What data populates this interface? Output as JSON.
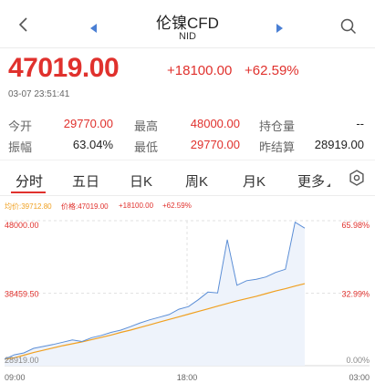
{
  "header": {
    "title": "伦镍CFD",
    "subtitle": "NID"
  },
  "quote": {
    "price": "47019.00",
    "change": "+18100.00",
    "change_pct": "+62.59%",
    "timestamp": "03-07 23:51:41"
  },
  "stats": {
    "open_label": "今开",
    "open_value": "29770.00",
    "high_label": "最高",
    "high_value": "48000.00",
    "position_label": "持仓量",
    "position_value": "--",
    "amplitude_label": "振幅",
    "amplitude_value": "63.04%",
    "low_label": "最低",
    "low_value": "29770.00",
    "prev_settle_label": "昨结算",
    "prev_settle_value": "28919.00"
  },
  "tabs": [
    {
      "label": "分时"
    },
    {
      "label": "五日"
    },
    {
      "label": "日K"
    },
    {
      "label": "周K"
    },
    {
      "label": "月K"
    },
    {
      "label": "更多"
    }
  ],
  "legend": {
    "avg": "均价:39712.80",
    "price": "价格:47019.00",
    "change": "+18100.00",
    "pct": "+62.59%"
  },
  "colors": {
    "up": "#e0312d",
    "price_line": "#5b8ed6",
    "avg_line": "#f0a020",
    "fill": "#eef3fb"
  },
  "chart_data": {
    "type": "line",
    "y_ticks_left": [
      "48000.00",
      "38459.50",
      "28919.00"
    ],
    "y_ticks_right": [
      "65.98%",
      "32.99%",
      "0.00%"
    ],
    "x_ticks": [
      "09:00",
      "18:00",
      "03:00"
    ],
    "ylim": [
      28919,
      48000
    ],
    "series": [
      {
        "name": "价格",
        "values": [
          29770,
          30350,
          30600,
          31200,
          31450,
          31700,
          32000,
          32300,
          32100,
          32600,
          32900,
          33300,
          33600,
          34050,
          34550,
          34950,
          35300,
          35650,
          36350,
          36700,
          37600,
          38600,
          38500,
          45500,
          39500,
          40100,
          40300,
          40600,
          41200,
          41600,
          47800,
          47019
        ]
      },
      {
        "name": "均价",
        "values": [
          29770,
          29950,
          30300,
          30650,
          30950,
          31250,
          31550,
          31800,
          32050,
          32350,
          32650,
          32950,
          33300,
          33600,
          33950,
          34300,
          34650,
          35000,
          35350,
          35700,
          36050,
          36400,
          36750,
          37100,
          37450,
          37750,
          38050,
          38400,
          38750,
          39050,
          39400,
          39712.8
        ]
      }
    ]
  }
}
